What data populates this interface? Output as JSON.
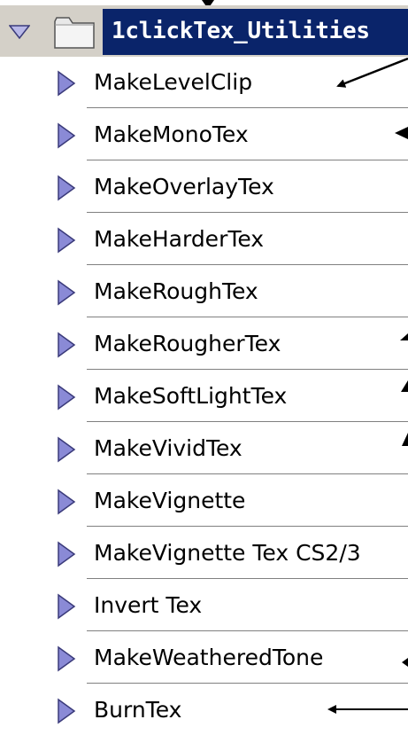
{
  "set": {
    "title": "1clickTex_Utilities",
    "expanded": true
  },
  "actions": [
    {
      "label": "MakeLevelClip"
    },
    {
      "label": "MakeMonoTex"
    },
    {
      "label": "MakeOverlayTex"
    },
    {
      "label": "MakeHarderTex"
    },
    {
      "label": "MakeRoughTex"
    },
    {
      "label": "MakeRougherTex"
    },
    {
      "label": "MakeSoftLightTex"
    },
    {
      "label": "MakeVividTex"
    },
    {
      "label": "MakeVignette"
    },
    {
      "label": "MakeVignette Tex CS2/3"
    },
    {
      "label": "Invert Tex"
    },
    {
      "label": "MakeWeatheredTone"
    },
    {
      "label": "BurnTex"
    }
  ],
  "icons": {
    "set_expander": "triangle-down-icon",
    "set_folder": "folder-icon",
    "action": "play-triangle-icon"
  },
  "colors": {
    "header_background": "#d4d0c8",
    "selection_background": "#0a246a",
    "selection_text": "#ffffff",
    "icon_fill": "#8a8ad6",
    "icon_stroke": "#3a3a7a",
    "divider": "#808080"
  }
}
